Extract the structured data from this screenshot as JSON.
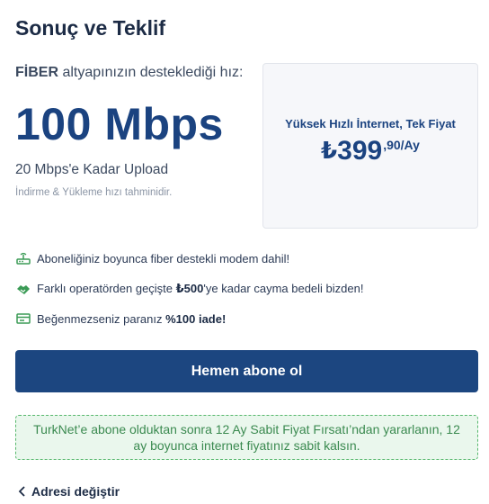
{
  "page": {
    "title": "Sonuç ve Teklif"
  },
  "speed": {
    "tech": "FİBER",
    "desc": "altyapınızın desteklediği hız:",
    "value": "100 Mbps",
    "upload": "20 Mbps'e Kadar Upload",
    "note": "İndirme & Yükleme hızı tahminidir."
  },
  "offer": {
    "plan_name": "Yüksek Hızlı İnternet, Tek Fiyat",
    "currency": "₺",
    "price_main": "399",
    "price_decimal": ",90/Ay"
  },
  "features": [
    {
      "icon": "modem-icon",
      "text": "Aboneliğiniz boyunca fiber destekli modem dahil!"
    },
    {
      "icon": "handshake-icon",
      "text_before": "Farklı operatörden geçişte ",
      "bold": "₺500",
      "text_after": "'ye kadar cayma bedeli bizden!"
    },
    {
      "icon": "money-icon",
      "text_before": "Beğenmezseniz paranız ",
      "bold": "%100 iade!"
    }
  ],
  "cta": {
    "label": "Hemen abone ol"
  },
  "promo": {
    "text": "TurkNet’e abone olduktan sonra 12 Ay Sabit Fiyat Fırsatı’ndan yararlanın, 12 ay boyunca internet fiyatınız sabit kalsın."
  },
  "back": {
    "label": "Adresi değiştir"
  },
  "colors": {
    "primary": "#1c4680",
    "accent_green": "#3b9b56",
    "promo_bg": "#eaf7ed"
  }
}
